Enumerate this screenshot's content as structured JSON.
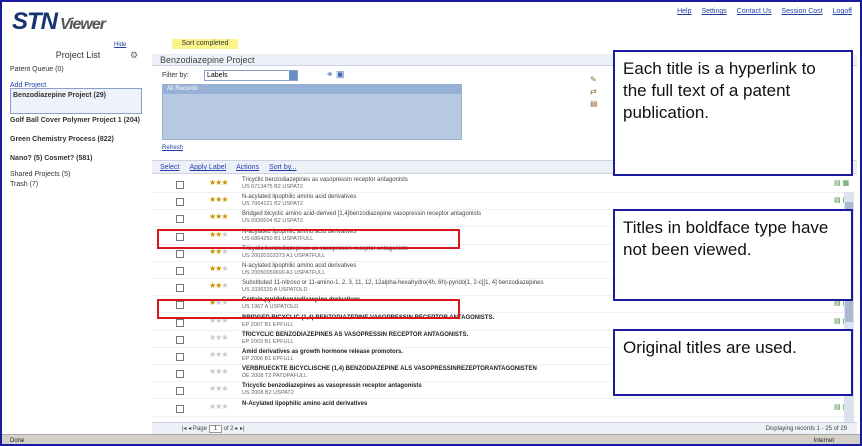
{
  "app": {
    "logo_main": "STN",
    "logo_sub": "Viewer",
    "toplinks": [
      "Help",
      "Settings",
      "Contact Us",
      "Session Cost",
      "Logoff"
    ]
  },
  "left_panel": {
    "hide_label": "Hide",
    "project_list_title": "Project List",
    "patent_queue": "Patent Queue (0)",
    "add_project": "Add Project",
    "projects": [
      "Benzodiazepine Project (29)",
      "Golf Ball Cover Polymer Project 1 (204)",
      "Green Chemistry Process (822)",
      "Nano? (5) Cosmet? (581)"
    ],
    "shared_projects": "Shared Projects (5)",
    "trash": "Trash (7)"
  },
  "status_banner": "Sort completed",
  "main": {
    "project_title": "Benzodiazepine Project",
    "filter_label": "Filter by:",
    "filter_value": "Labels",
    "records_item": "All Records",
    "refresh": "Refresh"
  },
  "toolbar": {
    "items": [
      "Select",
      "Apply Label",
      "Actions",
      "Sort by..."
    ]
  },
  "results": [
    {
      "stars": 3,
      "title": "Tricyclic benzodiazepines as vasopressin receptor antagonists",
      "source": "US 6713475 B2 USPAT2",
      "bold": false
    },
    {
      "stars": 3,
      "title": "N-acylated lipophilic amino acid derivatives",
      "source": "US 7064121 B2 USPAT2",
      "bold": false
    },
    {
      "stars": 3,
      "title": "Bridged bicyclic amino acid-derived [1,4]benzodiazepine vasopressin receptor antagonists",
      "source": "US 6936604 B2 USPAT2",
      "bold": false
    },
    {
      "stars": 2,
      "title": "N-acylated lipophilic amino acid derivatives",
      "source": "US 6864250 B1 USPATFULL",
      "bold": false
    },
    {
      "stars": 2,
      "title": "Tricyclic benzodiazepines as vasopressin receptor antagonists",
      "source": "US 20020103373 A1 USPATFULL",
      "bold": false
    },
    {
      "stars": 2,
      "title": "N-acylated lipophilic amino acid derivatives",
      "source": "US 20050059699 A1 USPATFULL",
      "bold": false
    },
    {
      "stars": 2,
      "title": "Substituted 11-nitroso or 11-amino-1, 2, 3, 11, 12, 12alpha-hexahydro(4h, 6h)-pyrido[1, 2-c][1, 4] benzodiazepines",
      "source": "US 3336320 A USPATOLD",
      "bold": false
    },
    {
      "stars": 1,
      "title": "Certain pyridobenzodiazepine derivatives",
      "source": "US 1967 A USPATOLD",
      "bold": true
    },
    {
      "stars": 0,
      "title": "BRIDGED BICYCLIC (1,4) BENZODIAZEPINE VASOPRESSIN RECEPTOR ANTAGONISTS.",
      "source": "EP 2007 B1 EPFULL",
      "bold": true
    },
    {
      "stars": 0,
      "title": "TRICYCLIC BENZODIAZEPINES AS VASOPRESSIN RECEPTOR ANTAGONISTS.",
      "source": "EP 2003 B1 EPFULL",
      "bold": true
    },
    {
      "stars": 0,
      "title": "Amid derivatives as growth hormone release promotors.",
      "source": "EP 2006 B1 EPFULL",
      "bold": true
    },
    {
      "stars": 0,
      "title": "VERBRUECKTE BICYCLISCHE (1,4) BENZODIAZEPINE ALS VASOPRESSINREZEPTORANTAGONISTEN",
      "source": "DE 2008 T2 PATDPAFULL",
      "bold": true
    },
    {
      "stars": 0,
      "title": "Tricyclic benzodiazepines as vasopressin receptor antagonists",
      "source": "US 2008 B2 USPAT2",
      "bold": true
    },
    {
      "stars": 0,
      "title": "N-Acylated lipophilic amino acid derivatives",
      "source": "",
      "bold": true
    }
  ],
  "pager": {
    "page_label": "Page",
    "page_value": "1",
    "of_label": "of 2",
    "display": "Displaying records 1 - 25 of 29"
  },
  "statusbar": {
    "left": "Done",
    "right": "Internet"
  },
  "callouts": {
    "c1": "Each title is a hyperlink to the full text of a patent publication.",
    "c2": "Titles in boldface type have not been viewed.",
    "c3": "Original titles are used."
  },
  "colors": {
    "callout_border": "#1a1aa0",
    "highlight_red": "#d8161b",
    "star_on": "#c99400"
  }
}
